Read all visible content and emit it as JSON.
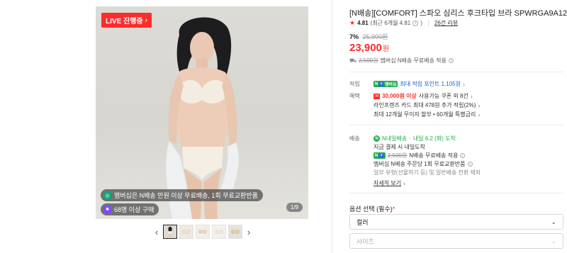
{
  "gallery": {
    "live_badge": "LIVE 진행중",
    "pill_membership": "멤버십은 N배송 만원 이상 무료배송, 1회 무료교환반품",
    "pill_purchase": "68명 이상 구매",
    "counter": "1/9",
    "prev_icon": "chevron-left-icon",
    "next_icon": "chevron-right-icon",
    "thumbnail_count": 5
  },
  "product": {
    "title": "[N배송][COMFORT] 스파오 심리스 후크타입 브라 SPWRGA9A12",
    "rating": {
      "score": "4.81",
      "recent": "(최근 6개월 4.81",
      "recent_close": ")",
      "reviews": "26건 리뷰"
    },
    "discount_pct": "7%",
    "original_price": "25,900원",
    "price": "23,900",
    "price_unit": "원",
    "shipping": {
      "fee_strike": "2,500원",
      "text": "멤버십 N배송 무료배송 적용"
    }
  },
  "benefits": {
    "points_label": "적립",
    "points_badge": "멤버십",
    "points_text": "최대 적립 포인트 1,105원",
    "benefit_label": "혜택",
    "coupon_amount": "30,000원 이상",
    "coupon_text": "사용가능 쿠폰 외 8건",
    "card_text": "라인프렌즈 카드 최대 478원 추가 적립(2%)",
    "installment_text": "최대 12개월 무이자 할부 • 60개월 특별금리"
  },
  "delivery": {
    "label": "배송",
    "n_label": "N내일배송",
    "arrival": "내일 6.2 (화) 도착",
    "order_now": "지금 결제 시 내일도착",
    "fee_strike": "2,500원",
    "fee_text": "N배송 무료배송 적용",
    "exchange": "멤버십 N배송 주문당 1회 무료교환반품",
    "exclude": "일부 유형(선물하기 등) 및 일반배송 전환 제외",
    "details": "자세히 보기"
  },
  "options": {
    "label": "옵션 선택",
    "required": "(필수)",
    "req_mark": "*",
    "color_placeholder": "컬러",
    "size_placeholder": "사이즈"
  },
  "colors": {
    "accent_red": "#ff2c2c",
    "naver_green": "#1fae4b",
    "link_blue": "#1b5fd8"
  }
}
